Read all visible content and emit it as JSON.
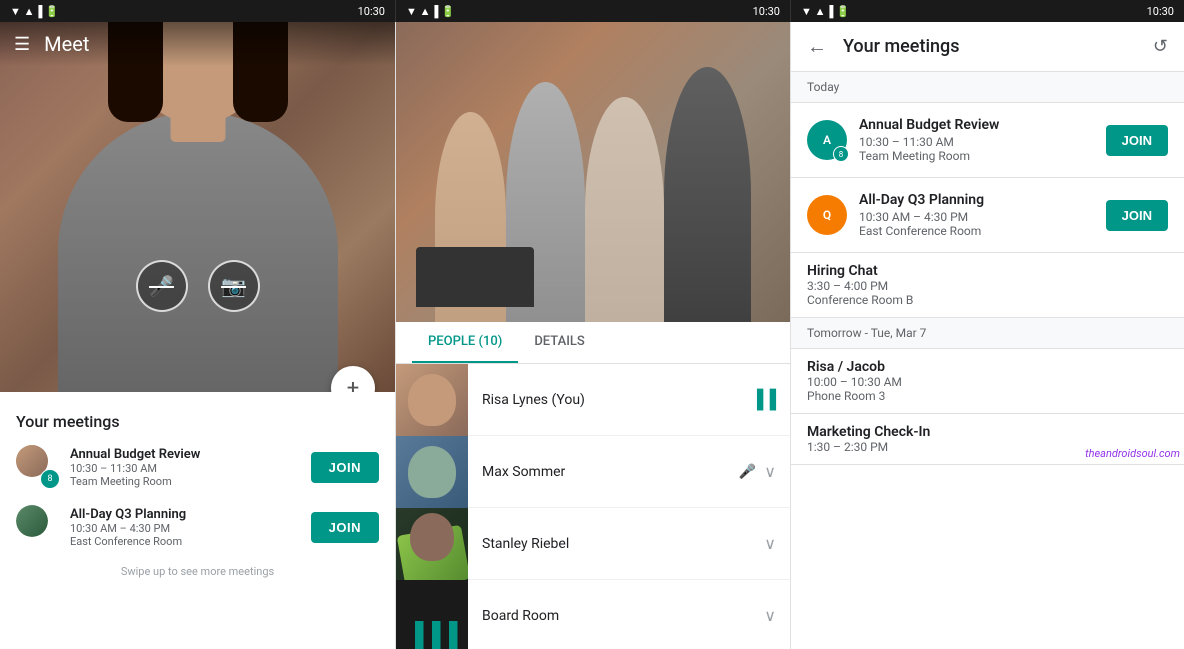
{
  "statusBar": {
    "time": "10:30",
    "icons": [
      "wifi",
      "signal",
      "battery"
    ]
  },
  "leftPanel": {
    "appTitle": "Meet",
    "sectionTitle": "Your meetings",
    "swipeHint": "Swipe up to see more meetings",
    "meetings": [
      {
        "title": "Annual Budget Review",
        "time": "10:30 – 11:30 AM",
        "room": "Team Meeting Room",
        "avatarCount": "8",
        "joinLabel": "JOIN"
      },
      {
        "title": "All-Day Q3 Planning",
        "time": "10:30 AM – 4:30 PM",
        "room": "East Conference Room",
        "avatarCount": "",
        "joinLabel": "JOIN"
      }
    ]
  },
  "midPanel": {
    "tabs": [
      {
        "label": "PEOPLE (10)",
        "active": true
      },
      {
        "label": "DETAILS",
        "active": false
      }
    ],
    "people": [
      {
        "name": "Risa Lynes (You)",
        "hasVolume": true,
        "hasMic": false,
        "hasChevron": false
      },
      {
        "name": "Max Sommer",
        "hasVolume": false,
        "hasMic": true,
        "hasChevron": true
      },
      {
        "name": "Stanley Riebel",
        "hasVolume": false,
        "hasMic": false,
        "hasChevron": true
      },
      {
        "name": "Board Room",
        "hasVolume": true,
        "hasMic": false,
        "hasChevron": true
      }
    ]
  },
  "rightPanel": {
    "title": "Your meetings",
    "backLabel": "←",
    "refreshLabel": "↺",
    "sections": [
      {
        "dateLabel": "Today",
        "meetings": [
          {
            "title": "Annual Budget Review",
            "time": "10:30 – 11:30 AM",
            "room": "Team Meeting Room",
            "showJoin": true,
            "joinLabel": "JOIN"
          },
          {
            "title": "All-Day Q3 Planning",
            "time": "10:30 AM – 4:30 PM",
            "room": "East Conference Room",
            "showJoin": true,
            "joinLabel": "JOIN"
          },
          {
            "title": "Hiring Chat",
            "time": "3:30 – 4:00 PM",
            "room": "Conference Room B",
            "showJoin": false,
            "joinLabel": ""
          }
        ]
      },
      {
        "dateLabel": "Tomorrow - Tue, Mar 7",
        "meetings": [
          {
            "title": "Risa / Jacob",
            "time": "10:00 – 10:30 AM",
            "room": "Phone Room 3",
            "showJoin": false,
            "joinLabel": ""
          },
          {
            "title": "Marketing Check-In",
            "time": "1:30 – 2:30 PM",
            "room": "",
            "showJoin": false,
            "joinLabel": ""
          }
        ]
      }
    ],
    "watermark": "theandroidsoul.com"
  }
}
